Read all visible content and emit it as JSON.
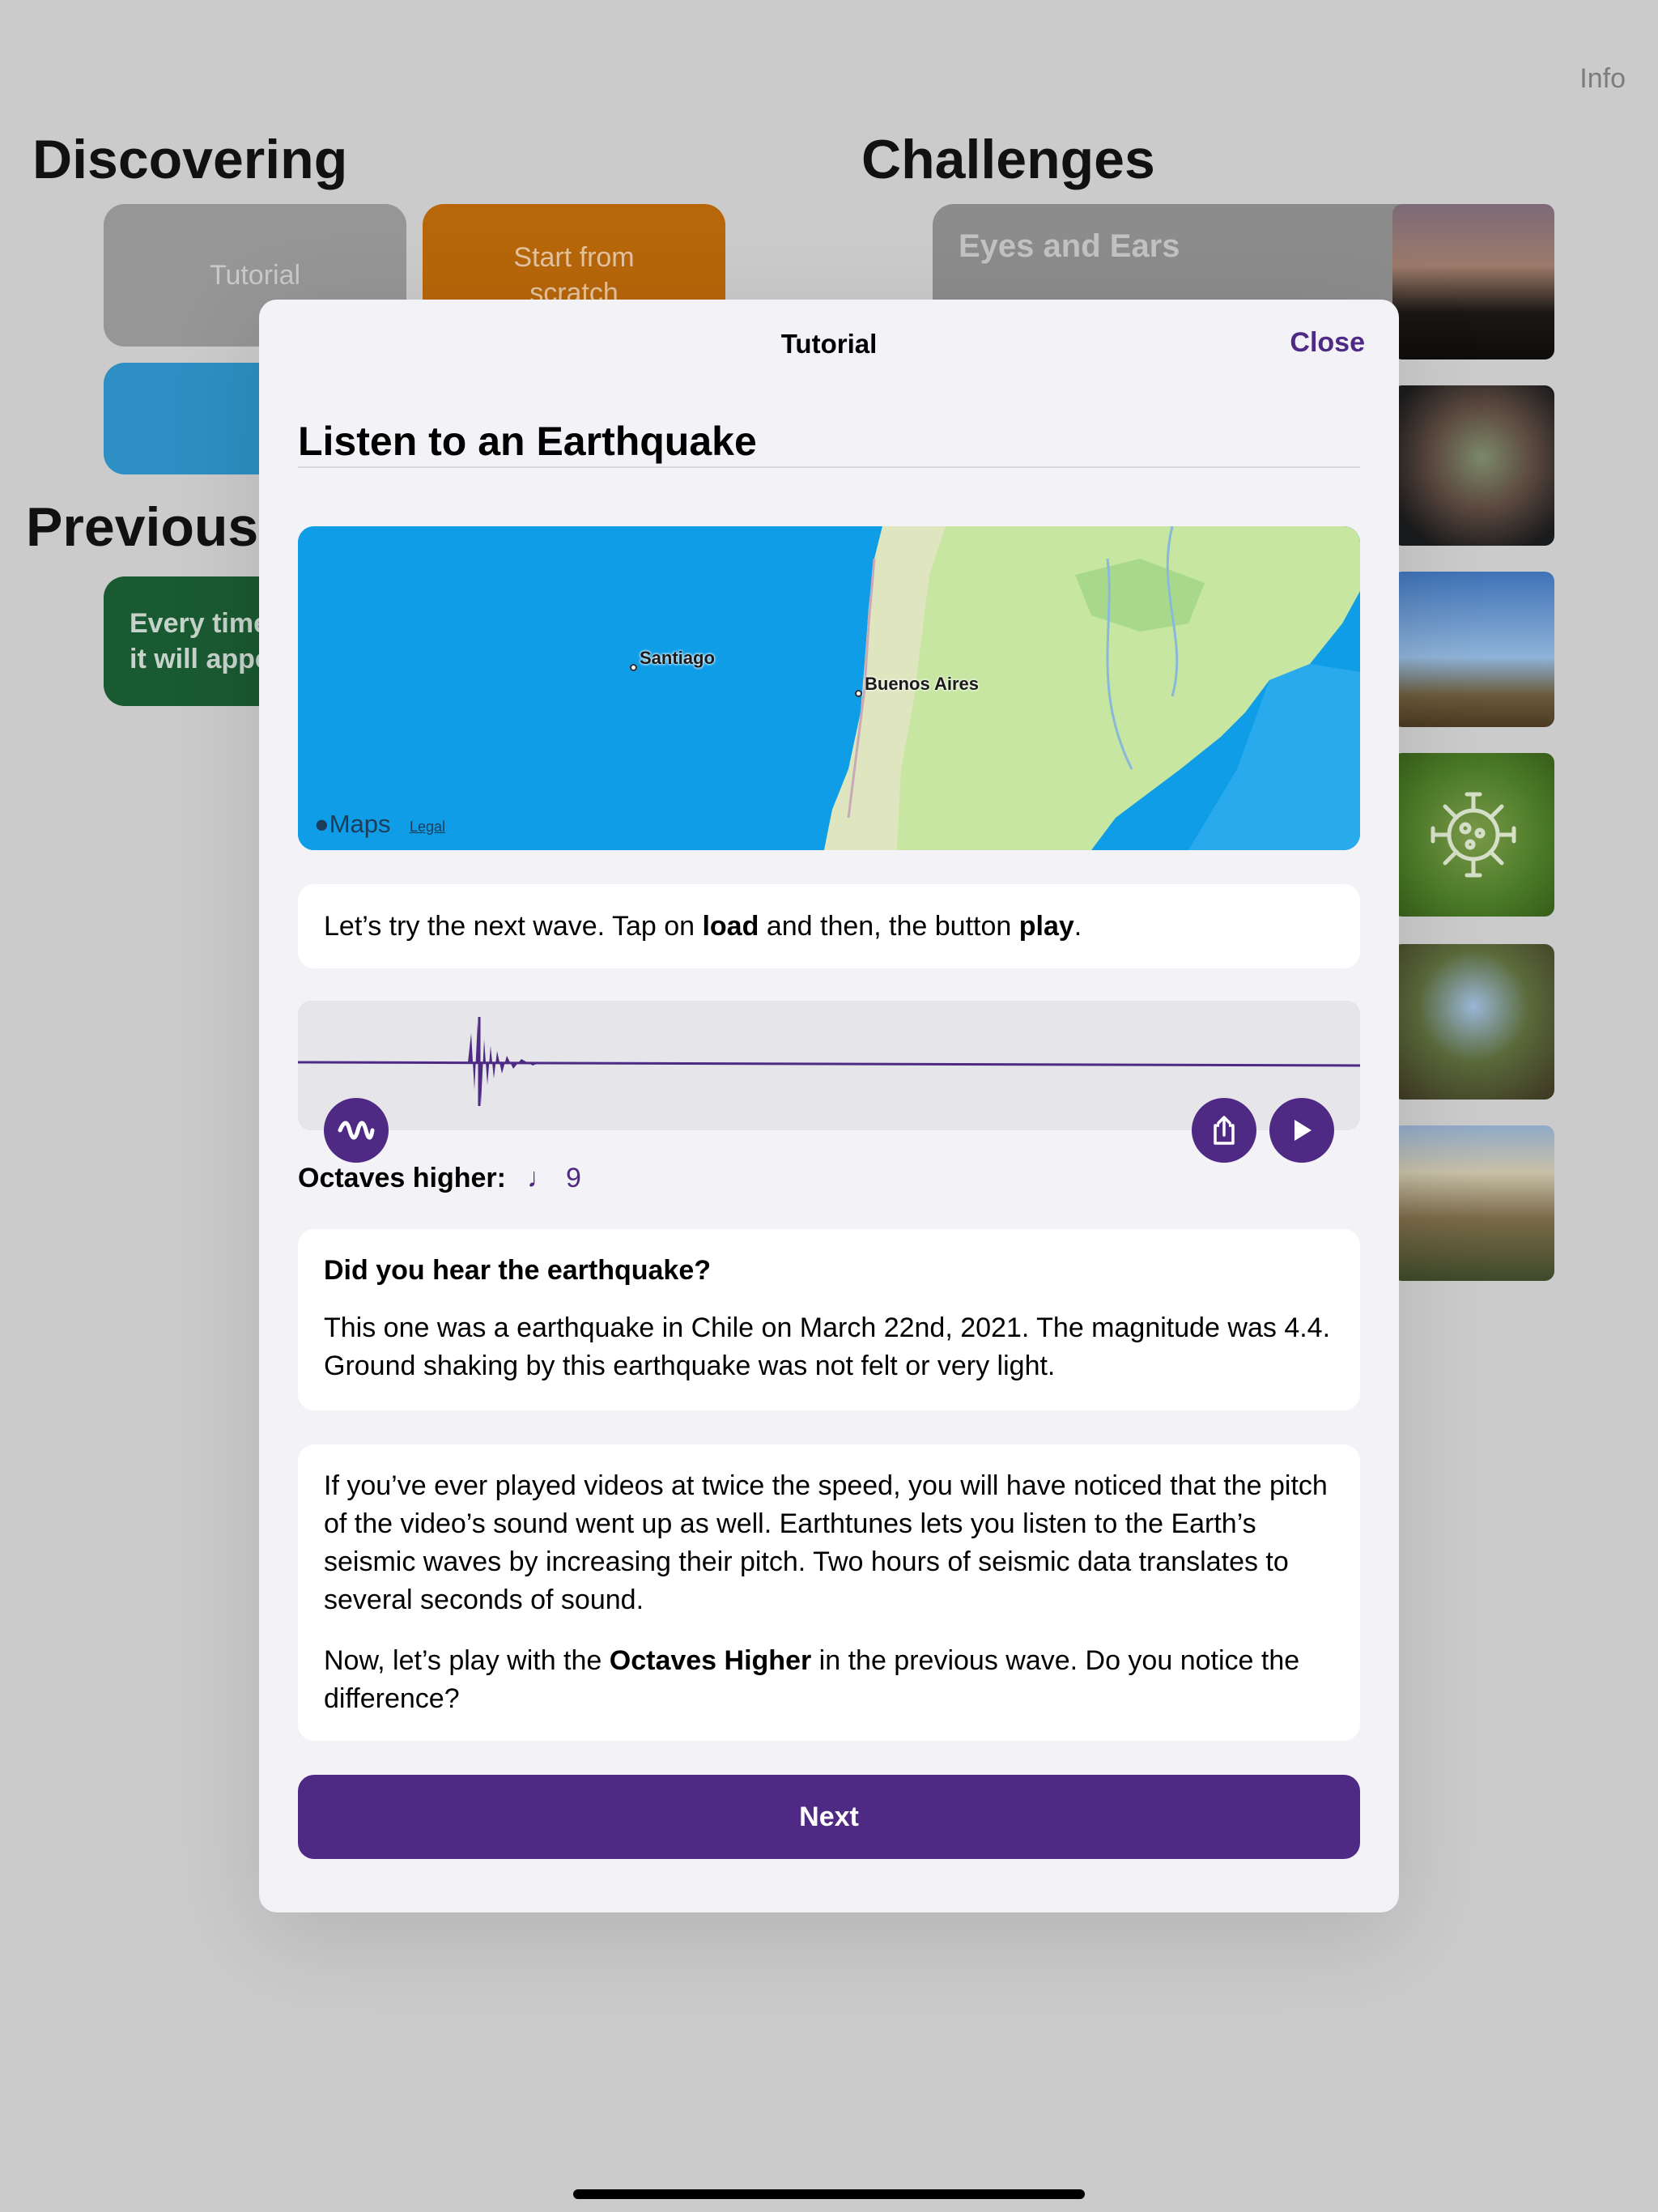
{
  "background": {
    "info_label": "Info",
    "discovering_title": "Discovering",
    "challenges_title": "Challenges",
    "previous_title": "Previous",
    "tutorial_card": "Tutorial",
    "start_card_line1": "Start from",
    "start_card_line2": "scratch",
    "previous_card_line1": "Every time",
    "previous_card_line2": "it will appe",
    "challenge_card": "Eyes and Ears"
  },
  "modal": {
    "title": "Tutorial",
    "close_label": "Close",
    "heading": "Listen to an Earthquake",
    "map": {
      "cities": [
        "Santiago",
        "Buenos Aires"
      ],
      "provider": "Maps",
      "legal": "Legal"
    },
    "instruction": {
      "pre": "Let’s try the next wave. Tap on ",
      "load": "load",
      "mid": " and then, the button ",
      "play": "play",
      "post": "."
    },
    "octaves": {
      "label": "Octaves higher:",
      "note": "♩",
      "value": "9"
    },
    "result": {
      "question": "Did you hear the earthquake?",
      "text": "This one was a earthquake in Chile on March 22nd, 2021. The magnitude was 4.4. Ground shaking by this earthquake was not felt or very light."
    },
    "explanation": {
      "paragraph1": "If you’ve ever played videos at twice the speed, you will have noticed that the pitch of the video’s sound went up as well. Earthtunes lets you listen to the Earth’s seismic waves by increasing their pitch. Two hours of seismic data translates to several seconds of sound.",
      "p2_pre": "Now, let’s play with the ",
      "p2_bold": "Octaves Higher",
      "p2_post": " in the previous wave. Do you notice the difference?"
    },
    "next_label": "Next"
  },
  "colors": {
    "accent": "#4e2a84",
    "backdrop": "#cbcbcb",
    "sheet": "#f2f2f7"
  },
  "icons": [
    "waveform-icon",
    "share-icon",
    "play-icon",
    "apple-icon",
    "virus-icon"
  ]
}
